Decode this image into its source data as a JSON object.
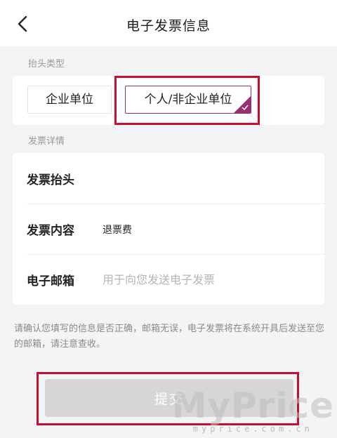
{
  "header": {
    "title": "电子发票信息",
    "back_icon": "chevron-left-icon"
  },
  "invoice_type": {
    "section_label": "抬头类型",
    "options": [
      {
        "label": "企业单位",
        "selected": false
      },
      {
        "label": "个人/非企业单位",
        "selected": true
      }
    ],
    "selected_accent": "#9a2e72"
  },
  "details": {
    "section_label": "发票详情",
    "rows": [
      {
        "label": "发票抬头",
        "value": ""
      },
      {
        "label": "发票内容",
        "value": "退票费"
      },
      {
        "label": "电子邮箱",
        "value": "",
        "placeholder": "用于向您发送电子发票"
      }
    ]
  },
  "notice": "请确认您填写的信息是否正确，邮箱无误，电子发票将在系统开具后发送至您的邮箱，请注意查收。",
  "submit_label": "提交",
  "highlight_color": "#c8102e",
  "watermark": {
    "main": "MyPrice",
    "sub": "myprice.com.cn"
  }
}
